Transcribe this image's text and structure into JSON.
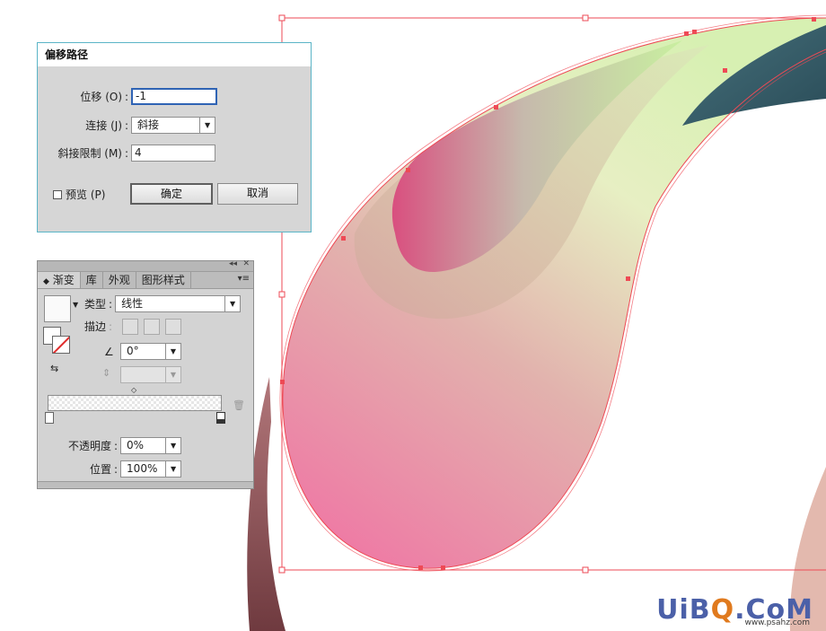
{
  "offset_dialog": {
    "title": "偏移路径",
    "offset_label": "位移 (O)",
    "offset_value": "-1",
    "joins_label": "连接 (J)",
    "joins_value": "斜接",
    "miter_label": "斜接限制 (M)",
    "miter_value": "4",
    "preview_label": "预览 (P)",
    "ok_label": "确定",
    "cancel_label": "取消"
  },
  "gradient_panel": {
    "tabs": [
      "渐变",
      "库",
      "外观",
      "图形样式"
    ],
    "type_label": "类型",
    "type_value": "线性",
    "stroke_label": "描边",
    "angle_value": "0°",
    "opacity_label": "不透明度",
    "opacity_value": "0%",
    "location_label": "位置",
    "location_value": "100%"
  },
  "watermark": {
    "text_ui": "UiB",
    "text_q": "Q",
    "text_rest": ".CoM",
    "sub": "www.psahz.com"
  },
  "colors": {
    "selection": "#ee4a55",
    "dialog_border": "#5bb5c7",
    "pink": "#f06fa2",
    "lime": "#cdeea4",
    "teal": "#2f5a67",
    "maroon": "#8a4a4e"
  }
}
